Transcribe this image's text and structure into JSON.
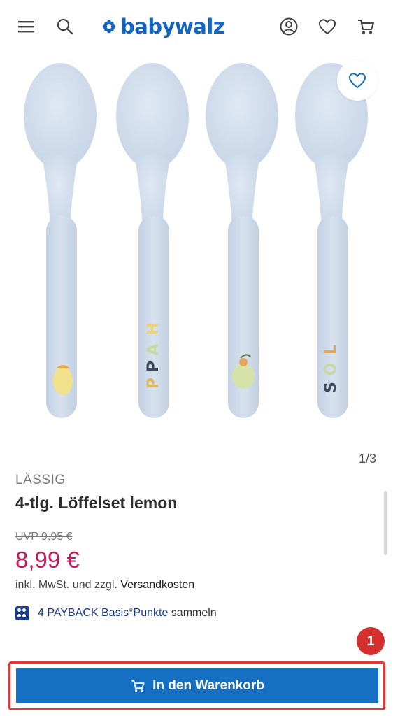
{
  "header": {
    "menu_icon": "hamburger-menu-icon",
    "search_icon": "search-icon",
    "logo_text": "babywalz",
    "account_icon": "user-icon",
    "wishlist_icon": "heart-icon",
    "cart_icon": "cart-icon",
    "brand_color": "#1565c0"
  },
  "gallery": {
    "counter": "1/3",
    "wishlist_icon": "heart-icon"
  },
  "product": {
    "brand": "LÄSSIG",
    "title": "4-tlg. Löffelset lemon",
    "uvp": "UVP 9,95 €",
    "price": "8,99 €",
    "tax_text": "inkl. MwSt. und zzgl. ",
    "shipping_link": "Versandkosten",
    "payback_points": "4 PAYBACK Basis°Punkte",
    "payback_suffix": " sammeln"
  },
  "actions": {
    "add_to_cart": "In den Warenkorb",
    "badge": "1"
  },
  "colors": {
    "price": "#c8195e",
    "primary_button": "#1570c4",
    "highlight": "#e53935"
  }
}
